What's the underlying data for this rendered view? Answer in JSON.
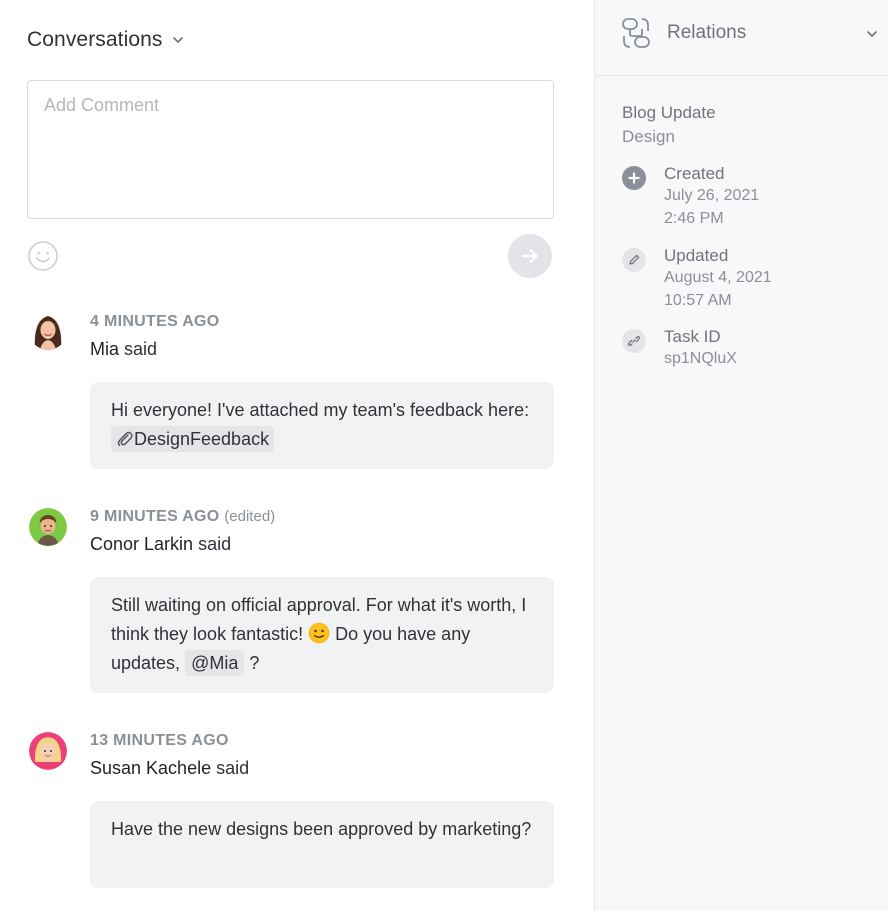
{
  "conversations": {
    "title": "Conversations",
    "input_placeholder": "Add Comment",
    "comments": [
      {
        "time": "4 MINUTES AGO",
        "edited": "",
        "author": "Mia",
        "said": "said",
        "text_before": "Hi everyone! I've attached my team's feedback here: ",
        "attachment": "DesignFeedback"
      },
      {
        "time": "9 MINUTES AGO",
        "edited": "(edited)",
        "author": "Conor Larkin",
        "said": "said",
        "text_before": "Still waiting on official approval. For what it's worth, I think they look fantastic! ",
        "text_after": " Do you have any updates, ",
        "mention": "@Mia",
        "text_end": " ?"
      },
      {
        "time": "13 MINUTES AGO",
        "edited": "",
        "author": "Susan Kachele",
        "said": "said",
        "text_before": "Have the new designs been approved by marketing?"
      }
    ]
  },
  "relations": {
    "title": "Relations",
    "item_title": "Blog Update",
    "item_subtitle": "Design",
    "created": {
      "label": "Created",
      "date": "July 26, 2021",
      "time": "2:46 PM"
    },
    "updated": {
      "label": "Updated",
      "date": "August 4, 2021",
      "time": "10:57 AM"
    },
    "task": {
      "label": "Task ID",
      "value": "sp1NQluX"
    }
  },
  "icons": [
    "chevron-down-icon",
    "emoji-icon",
    "arrow-right-icon",
    "paperclip-icon",
    "slightly-smiling-emoji",
    "relations-icon",
    "plus-circle-icon",
    "pencil-icon",
    "link-icon"
  ],
  "colors": {
    "bubble": "#f1f2f4",
    "panel": "#f7f8f9",
    "muted": "#8a8f98",
    "text": "#2f3237"
  }
}
